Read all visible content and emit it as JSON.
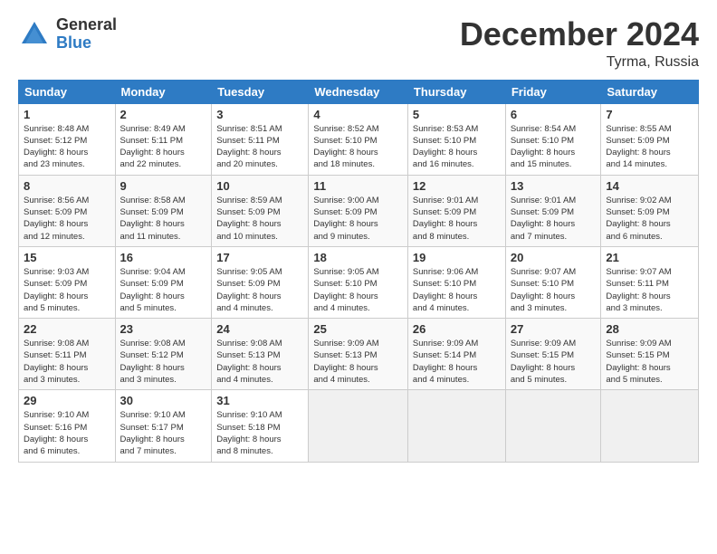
{
  "header": {
    "logo_general": "General",
    "logo_blue": "Blue",
    "month_title": "December 2024",
    "location": "Tyrma, Russia"
  },
  "days_of_week": [
    "Sunday",
    "Monday",
    "Tuesday",
    "Wednesday",
    "Thursday",
    "Friday",
    "Saturday"
  ],
  "weeks": [
    [
      {
        "day": "1",
        "info": "Sunrise: 8:48 AM\nSunset: 5:12 PM\nDaylight: 8 hours\nand 23 minutes."
      },
      {
        "day": "2",
        "info": "Sunrise: 8:49 AM\nSunset: 5:11 PM\nDaylight: 8 hours\nand 22 minutes."
      },
      {
        "day": "3",
        "info": "Sunrise: 8:51 AM\nSunset: 5:11 PM\nDaylight: 8 hours\nand 20 minutes."
      },
      {
        "day": "4",
        "info": "Sunrise: 8:52 AM\nSunset: 5:10 PM\nDaylight: 8 hours\nand 18 minutes."
      },
      {
        "day": "5",
        "info": "Sunrise: 8:53 AM\nSunset: 5:10 PM\nDaylight: 8 hours\nand 16 minutes."
      },
      {
        "day": "6",
        "info": "Sunrise: 8:54 AM\nSunset: 5:10 PM\nDaylight: 8 hours\nand 15 minutes."
      },
      {
        "day": "7",
        "info": "Sunrise: 8:55 AM\nSunset: 5:09 PM\nDaylight: 8 hours\nand 14 minutes."
      }
    ],
    [
      {
        "day": "8",
        "info": "Sunrise: 8:56 AM\nSunset: 5:09 PM\nDaylight: 8 hours\nand 12 minutes."
      },
      {
        "day": "9",
        "info": "Sunrise: 8:58 AM\nSunset: 5:09 PM\nDaylight: 8 hours\nand 11 minutes."
      },
      {
        "day": "10",
        "info": "Sunrise: 8:59 AM\nSunset: 5:09 PM\nDaylight: 8 hours\nand 10 minutes."
      },
      {
        "day": "11",
        "info": "Sunrise: 9:00 AM\nSunset: 5:09 PM\nDaylight: 8 hours\nand 9 minutes."
      },
      {
        "day": "12",
        "info": "Sunrise: 9:01 AM\nSunset: 5:09 PM\nDaylight: 8 hours\nand 8 minutes."
      },
      {
        "day": "13",
        "info": "Sunrise: 9:01 AM\nSunset: 5:09 PM\nDaylight: 8 hours\nand 7 minutes."
      },
      {
        "day": "14",
        "info": "Sunrise: 9:02 AM\nSunset: 5:09 PM\nDaylight: 8 hours\nand 6 minutes."
      }
    ],
    [
      {
        "day": "15",
        "info": "Sunrise: 9:03 AM\nSunset: 5:09 PM\nDaylight: 8 hours\nand 5 minutes."
      },
      {
        "day": "16",
        "info": "Sunrise: 9:04 AM\nSunset: 5:09 PM\nDaylight: 8 hours\nand 5 minutes."
      },
      {
        "day": "17",
        "info": "Sunrise: 9:05 AM\nSunset: 5:09 PM\nDaylight: 8 hours\nand 4 minutes."
      },
      {
        "day": "18",
        "info": "Sunrise: 9:05 AM\nSunset: 5:10 PM\nDaylight: 8 hours\nand 4 minutes."
      },
      {
        "day": "19",
        "info": "Sunrise: 9:06 AM\nSunset: 5:10 PM\nDaylight: 8 hours\nand 4 minutes."
      },
      {
        "day": "20",
        "info": "Sunrise: 9:07 AM\nSunset: 5:10 PM\nDaylight: 8 hours\nand 3 minutes."
      },
      {
        "day": "21",
        "info": "Sunrise: 9:07 AM\nSunset: 5:11 PM\nDaylight: 8 hours\nand 3 minutes."
      }
    ],
    [
      {
        "day": "22",
        "info": "Sunrise: 9:08 AM\nSunset: 5:11 PM\nDaylight: 8 hours\nand 3 minutes."
      },
      {
        "day": "23",
        "info": "Sunrise: 9:08 AM\nSunset: 5:12 PM\nDaylight: 8 hours\nand 3 minutes."
      },
      {
        "day": "24",
        "info": "Sunrise: 9:08 AM\nSunset: 5:13 PM\nDaylight: 8 hours\nand 4 minutes."
      },
      {
        "day": "25",
        "info": "Sunrise: 9:09 AM\nSunset: 5:13 PM\nDaylight: 8 hours\nand 4 minutes."
      },
      {
        "day": "26",
        "info": "Sunrise: 9:09 AM\nSunset: 5:14 PM\nDaylight: 8 hours\nand 4 minutes."
      },
      {
        "day": "27",
        "info": "Sunrise: 9:09 AM\nSunset: 5:15 PM\nDaylight: 8 hours\nand 5 minutes."
      },
      {
        "day": "28",
        "info": "Sunrise: 9:09 AM\nSunset: 5:15 PM\nDaylight: 8 hours\nand 5 minutes."
      }
    ],
    [
      {
        "day": "29",
        "info": "Sunrise: 9:10 AM\nSunset: 5:16 PM\nDaylight: 8 hours\nand 6 minutes."
      },
      {
        "day": "30",
        "info": "Sunrise: 9:10 AM\nSunset: 5:17 PM\nDaylight: 8 hours\nand 7 minutes."
      },
      {
        "day": "31",
        "info": "Sunrise: 9:10 AM\nSunset: 5:18 PM\nDaylight: 8 hours\nand 8 minutes."
      },
      null,
      null,
      null,
      null
    ]
  ]
}
